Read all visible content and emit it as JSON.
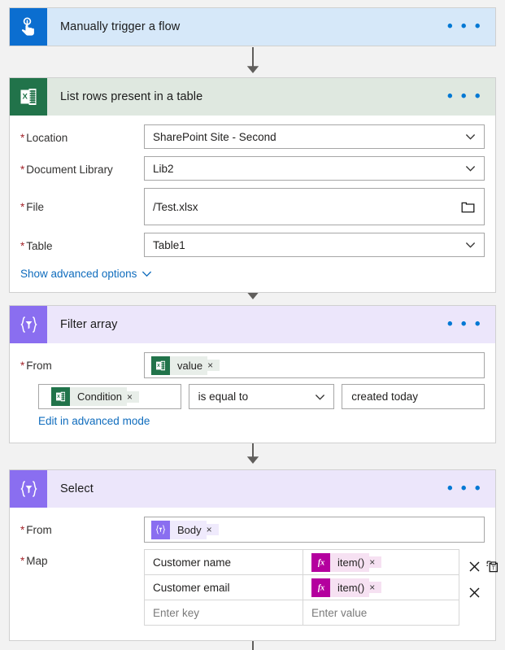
{
  "colors": {
    "trigger_header": "#d6e8f9",
    "trigger_icon": "#0b6ed0",
    "excel_header": "#dfe8e0",
    "excel_icon": "#21734a",
    "scope_header": "#ece6fb",
    "scope_icon": "#8a6ef0",
    "fx_icon": "#b4009e",
    "link": "#0f6cbd",
    "required": "#a4262c",
    "canvas": "#f2f2f2"
  },
  "menu_glyph": "• • •",
  "cards": {
    "trigger": {
      "title": "Manually trigger a flow",
      "icon": "touch-trigger-icon",
      "menu": "more-commands"
    },
    "list_rows": {
      "title": "List rows present in a table",
      "icon": "excel-icon",
      "fields": [
        {
          "label": "Location",
          "required": true,
          "value": "SharePoint Site - Second",
          "control": "dropdown"
        },
        {
          "label": "Document Library",
          "required": true,
          "value": "Lib2",
          "control": "dropdown"
        },
        {
          "label": "File",
          "required": true,
          "value": "/Test.xlsx",
          "control": "file-picker"
        },
        {
          "label": "Table",
          "required": true,
          "value": "Table1",
          "control": "dropdown"
        }
      ],
      "advanced_link": "Show advanced options"
    },
    "filter_array": {
      "title": "Filter array",
      "icon": "filter-scope-icon",
      "from_label": "From",
      "from_required": true,
      "from_token": {
        "text": "value",
        "icon": "excel-icon",
        "remove": "×"
      },
      "condition": {
        "field_token": {
          "text": "Condition",
          "icon": "excel-icon",
          "remove": "×"
        },
        "operator": "is equal to",
        "value": "created today"
      },
      "advanced_link": "Edit in advanced mode"
    },
    "select": {
      "title": "Select",
      "icon": "filter-scope-icon",
      "from_label": "From",
      "from_required": true,
      "from_token": {
        "text": "Body",
        "icon": "scope-icon",
        "remove": "×"
      },
      "map_label": "Map",
      "map_required": true,
      "map_rows": [
        {
          "key": "Customer name",
          "value_token": "item()",
          "value_icon": "fx-icon",
          "key_placeholder": false,
          "actions": [
            "delete",
            "duplicate"
          ]
        },
        {
          "key": "Customer email",
          "value_token": "item()",
          "value_icon": "fx-icon",
          "key_placeholder": false,
          "actions": [
            "delete"
          ]
        },
        {
          "key": "Enter key",
          "value": "Enter value",
          "key_placeholder": true,
          "actions": []
        }
      ],
      "remove_glyph": "×"
    }
  }
}
